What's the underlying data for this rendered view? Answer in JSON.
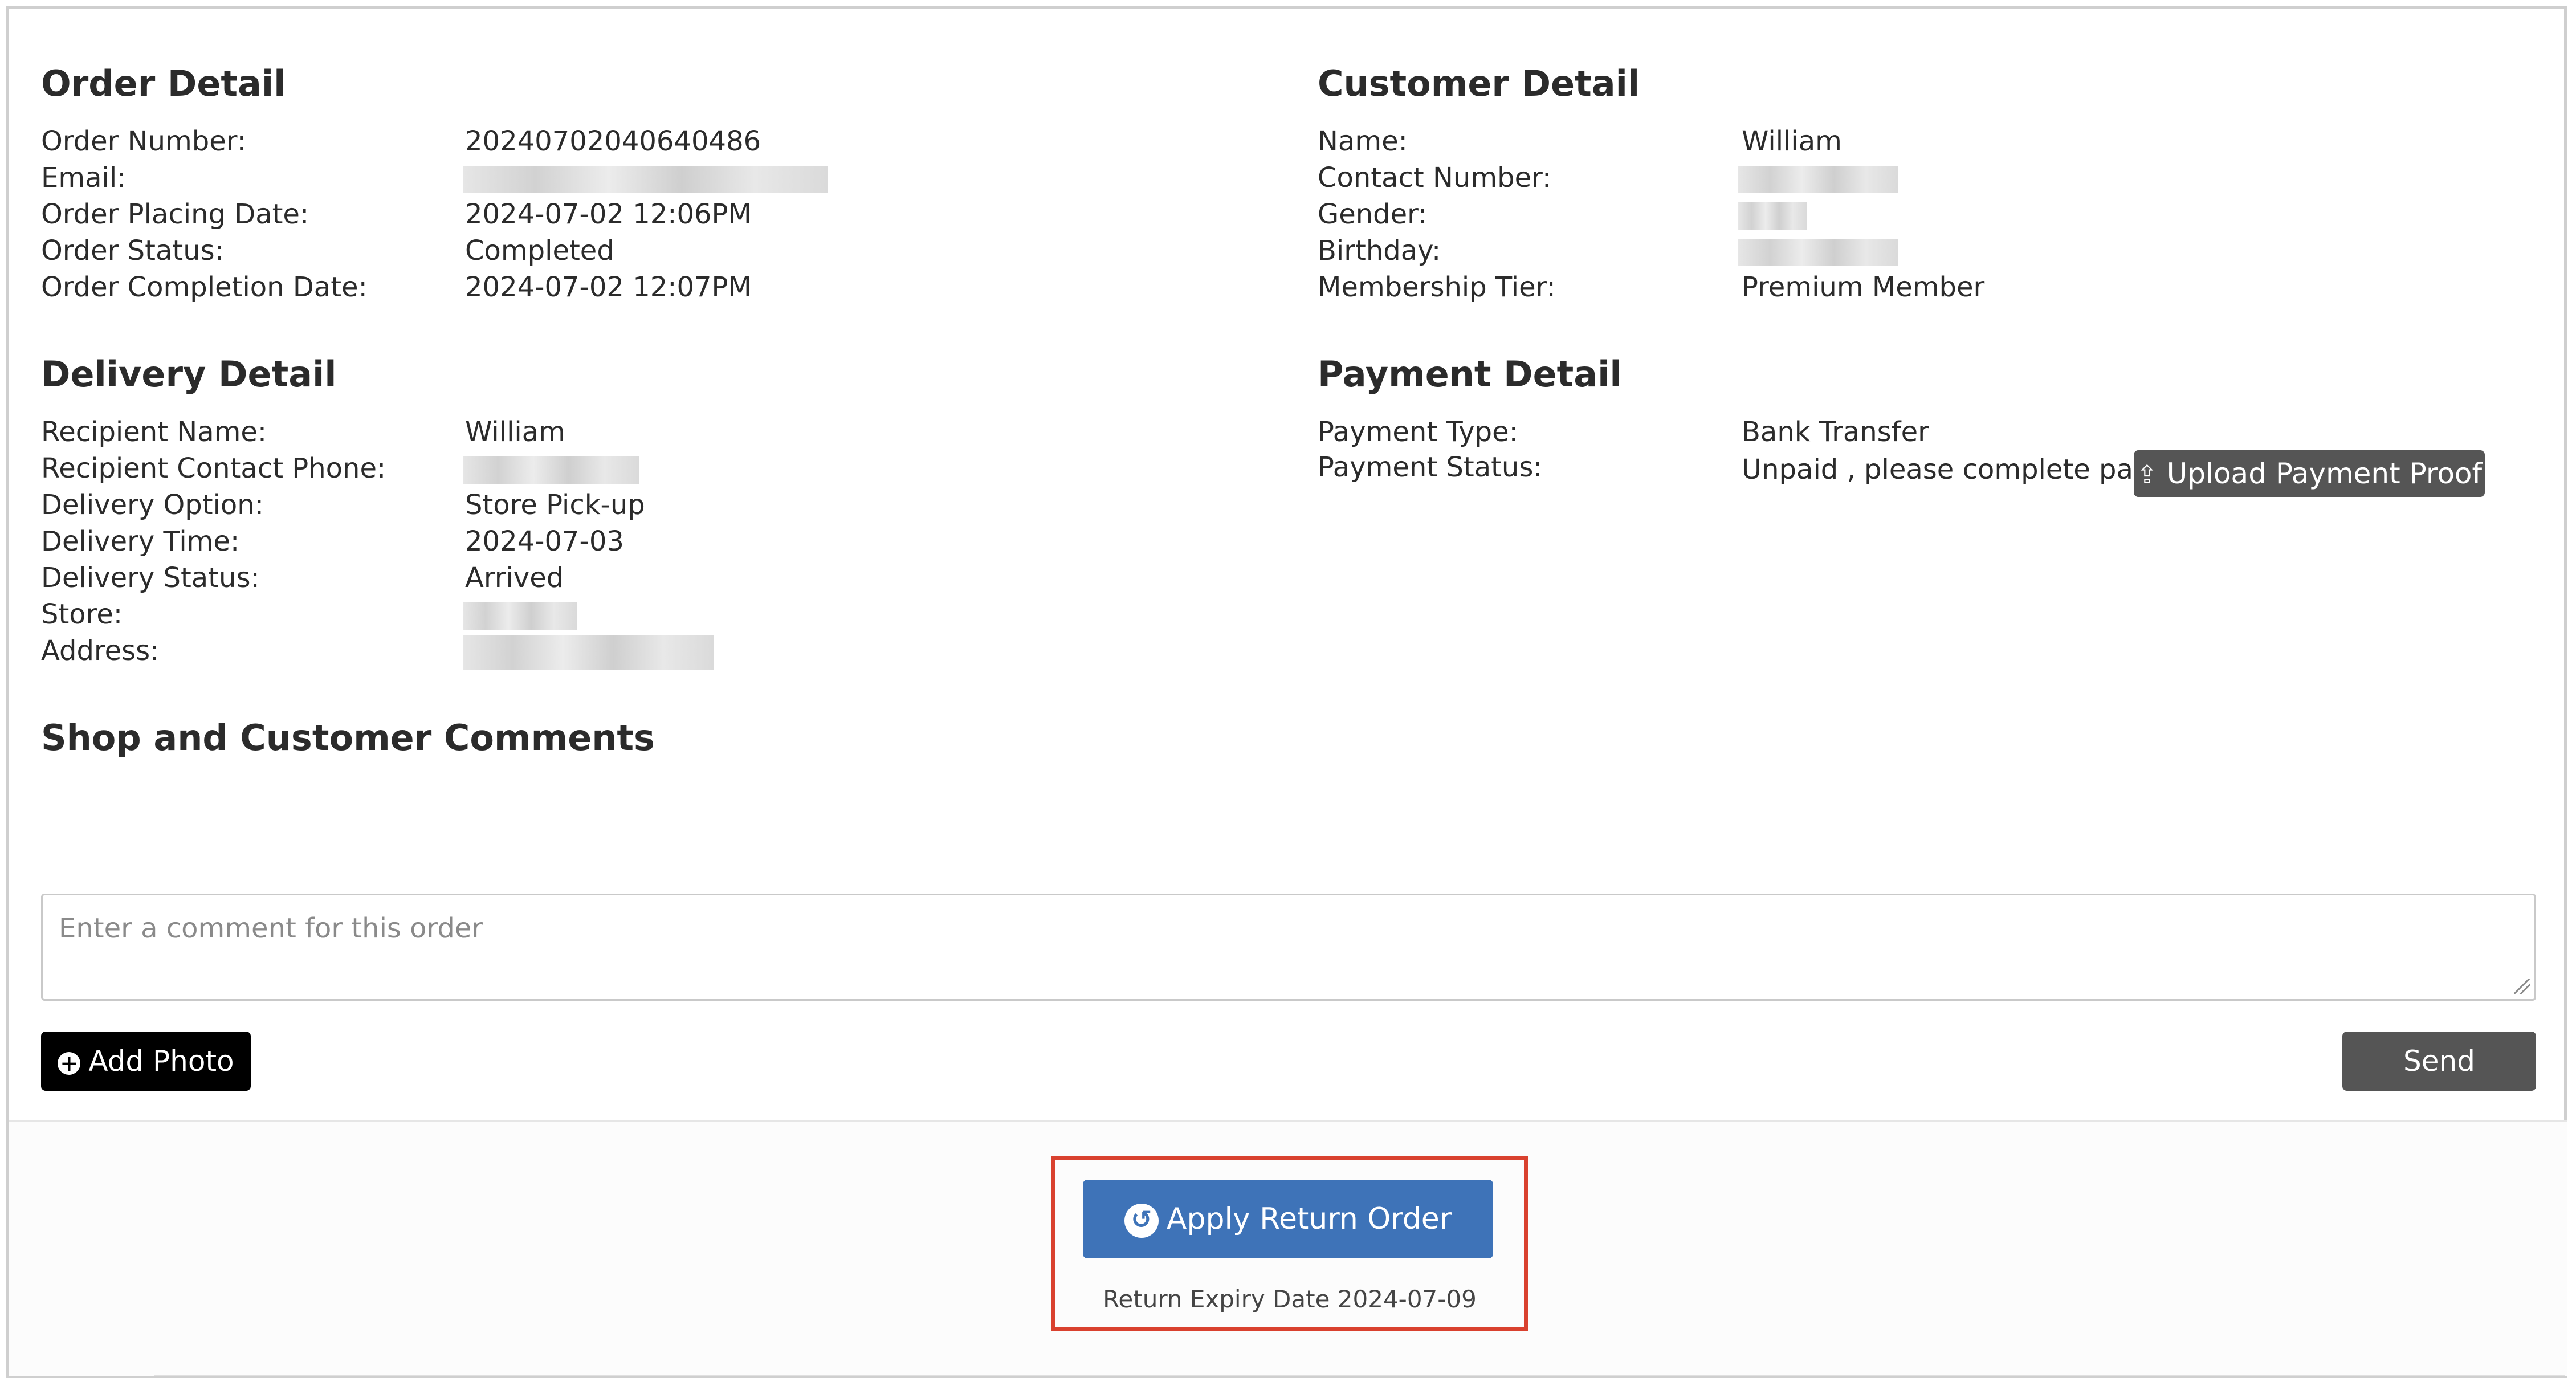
{
  "order": {
    "title": "Order Detail",
    "labels": [
      "Order Number:",
      "Email:",
      "Order Placing Date:",
      "Order Status:",
      "Order Completion Date:"
    ],
    "number": "20240702040640486",
    "placing_date": "2024-07-02 12:06PM",
    "status": "Completed",
    "completion_date": "2024-07-02 12:07PM"
  },
  "customer": {
    "title": "Customer Detail",
    "labels": [
      "Name:",
      "Contact Number:",
      "Gender:",
      "Birthday:",
      "Membership Tier:"
    ],
    "name": "William",
    "tier": "Premium Member"
  },
  "delivery": {
    "title": "Delivery Detail",
    "labels": [
      "Recipient Name:",
      "Recipient Contact Phone:",
      "Delivery Option:",
      "Delivery Time:",
      "Delivery Status:",
      "Store:",
      "Address:"
    ],
    "recipient": "William",
    "option": "Store Pick-up",
    "time": "2024-07-03",
    "status": "Arrived"
  },
  "payment": {
    "title": "Payment Detail",
    "labels": [
      "Payment Type:",
      "Payment Status:"
    ],
    "type": "Bank Transfer",
    "status": "Unpaid , please complete paid",
    "upload_label": "Upload Payment Proof"
  },
  "comments": {
    "title": "Shop and Customer Comments",
    "placeholder": "Enter a comment for this order",
    "add_photo_label": "Add Photo",
    "send_label": "Send"
  },
  "return": {
    "button_label": "Apply Return Order",
    "expiry_text": "Return Expiry Date 2024-07-09"
  },
  "colors": {
    "primary_blue": "#3e73b8",
    "dark_button": "#555555",
    "highlight_red": "#d9412f"
  }
}
